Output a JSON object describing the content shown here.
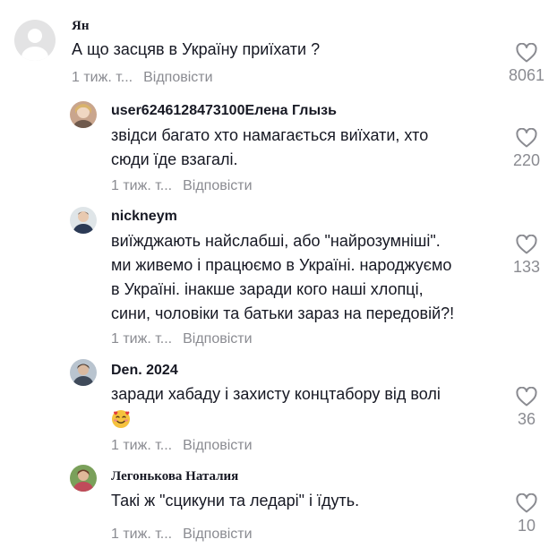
{
  "comments": [
    {
      "username": "Ян",
      "lines": [
        "А що засцяв в Україну приїхати ?"
      ],
      "time": "1 тиж. т...",
      "reply": "Відповісти",
      "likes": "8061"
    },
    {
      "username": "user6246128473100Елена Глызь",
      "lines": [
        "звідси багато хто намагається виїхати, хто",
        "сюди їде взагалі."
      ],
      "time": "1 тиж. т...",
      "reply": "Відповісти",
      "likes": "220"
    },
    {
      "username": "nickneym",
      "lines": [
        "виїжджають найслабші, або \"найрозумніші\".",
        "ми живемо і працюємо в Україні. народжуємо",
        "в Україні. інакше заради кого наші хлопці,",
        "сини, чоловіки та батьки зараз на передовій?!"
      ],
      "time": "1 тиж. т...",
      "reply": "Відповісти",
      "likes": "133"
    },
    {
      "username": "Den. 2024",
      "lines": [
        "заради хабаду і захисту концтабору від волі"
      ],
      "emoji": "smiling-face-with-hearts",
      "time": "1 тиж. т...",
      "reply": "Відповісти",
      "likes": "36"
    },
    {
      "username": "Легонькова Наталия",
      "lines": [
        "Такі ж \"сцикуни та ледарі\" і їдуть."
      ],
      "time": "1 тиж. т...",
      "reply": "Відповісти",
      "likes": "10"
    }
  ],
  "colors": {
    "text": "#161823",
    "muted": "#8a8b91",
    "heart": "#8a8b91"
  },
  "icons": {
    "like": "heart-outline-icon"
  }
}
